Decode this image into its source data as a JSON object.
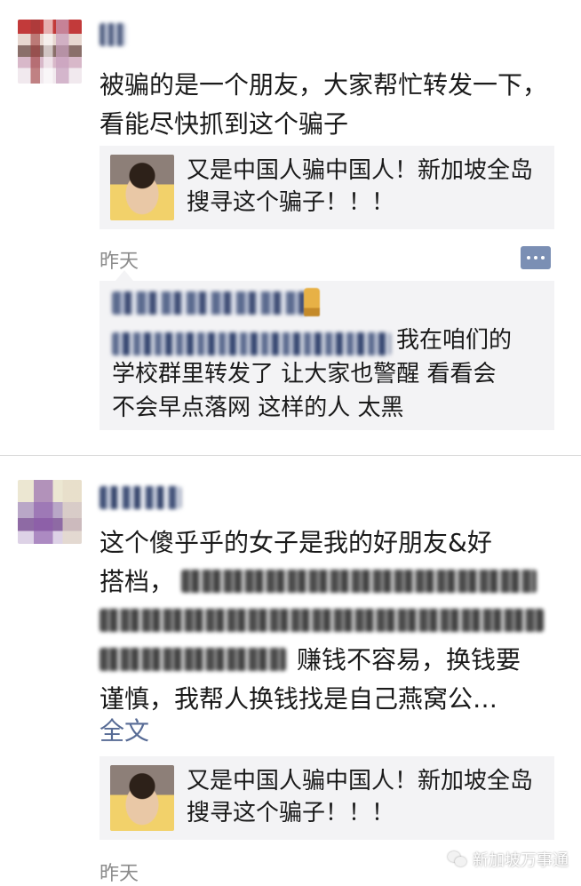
{
  "post1": {
    "text": "被骗的是一个朋友，大家帮忙转发一下，看能尽快抓到这个骗子",
    "share_title": "又是中国人骗中国人！新加坡全岛搜寻这个骗子！！！",
    "timestamp": "昨天",
    "comment": {
      "line1_visible": "我在咱们的",
      "line2": "学校群里转发了 让大家也警醒 看看会",
      "line3": "不会早点落网 这样的人 太黑"
    }
  },
  "post2": {
    "text_line1": "这个傻乎乎的女子是我的好朋友&好",
    "text_line2_visible": "搭档，",
    "text_line4_visible": "赚钱不容易，换钱要",
    "text_line5": "谨慎，我帮人换钱找是自己燕窝公…",
    "full_text_link": "全文",
    "share_title": "又是中国人骗中国人！新加坡全岛搜寻这个骗子！！！",
    "timestamp": "昨天"
  },
  "watermark": {
    "text": "新加坡万事通"
  }
}
